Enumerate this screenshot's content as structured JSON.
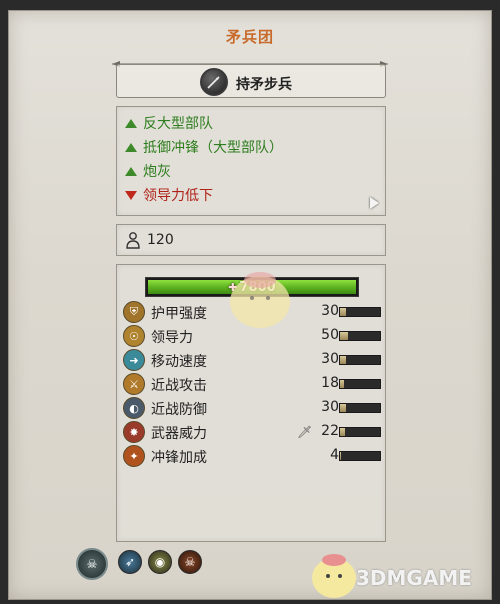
{
  "title": "矛兵团",
  "unit": {
    "name": "持矛步兵",
    "icon": "spear-icon"
  },
  "attributes": [
    {
      "label": "反大型部队",
      "type": "positive"
    },
    {
      "label": "抵御冲锋（大型部队）",
      "type": "positive"
    },
    {
      "label": "炮灰",
      "type": "positive"
    },
    {
      "label": "领导力低下",
      "type": "negative"
    }
  ],
  "unit_count": "120",
  "hp": {
    "value": "7800",
    "fill": 1.0
  },
  "stats": [
    {
      "label": "护甲强度",
      "value": "30",
      "icon": "armor-icon",
      "fill": 0.15
    },
    {
      "label": "领导力",
      "value": "50",
      "icon": "leadership-icon",
      "fill": 0.2
    },
    {
      "label": "移动速度",
      "value": "30",
      "icon": "speed-icon",
      "fill": 0.15
    },
    {
      "label": "近战攻击",
      "value": "18",
      "icon": "melee-attack-icon",
      "fill": 0.1
    },
    {
      "label": "近战防御",
      "value": "30",
      "icon": "melee-defense-icon",
      "fill": 0.15
    },
    {
      "label": "武器威力",
      "value": "22",
      "icon": "weapon-strength-icon",
      "fill": 0.12
    },
    {
      "label": "冲锋加成",
      "value": "4",
      "icon": "charge-bonus-icon",
      "fill": 0.03
    }
  ],
  "abilities": [
    {
      "icon": "skull-ability-icon",
      "color": "#3a4a4c"
    },
    {
      "icon": "arrow-ability-icon",
      "color": "#2f5f7a"
    },
    {
      "icon": "eye-ability-icon",
      "color": "#4a4a3a"
    },
    {
      "icon": "skull-red-ability-icon",
      "color": "#5a2a1a"
    }
  ],
  "colors": {
    "title": "#c76a2a",
    "positive": "#2e7d1e",
    "negative": "#b02218",
    "hp_bar": "#5fb522"
  },
  "watermark": "3DMGAME"
}
